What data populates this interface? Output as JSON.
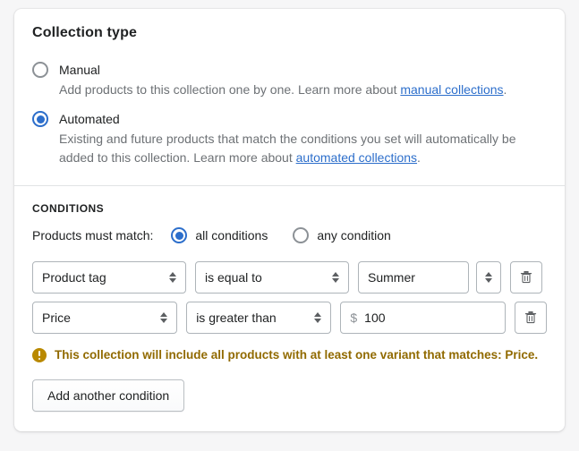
{
  "card": {
    "title": "Collection type",
    "options": [
      {
        "label": "Manual",
        "selected": false,
        "help_prefix": "Add products to this collection one by one. Learn more about ",
        "help_link": "manual collections",
        "help_suffix": "."
      },
      {
        "label": "Automated",
        "selected": true,
        "help_prefix": "Existing and future products that match the conditions you set will automatically be added to this collection. Learn more about ",
        "help_link": "automated collections",
        "help_suffix": "."
      }
    ]
  },
  "conditions": {
    "heading": "CONDITIONS",
    "match_label": "Products must match:",
    "match_options": [
      {
        "label": "all conditions",
        "selected": true
      },
      {
        "label": "any condition",
        "selected": false
      }
    ],
    "rows": [
      {
        "field": "Product tag",
        "operator": "is equal to",
        "value": "Summer",
        "currency_prefix": "",
        "has_stepper": true,
        "delete_icon": "trash-icon"
      },
      {
        "field": "Price",
        "operator": "is greater than",
        "value": "100",
        "currency_prefix": "$",
        "has_stepper": false,
        "delete_icon": "trash-icon"
      }
    ],
    "warning": {
      "icon": "alert-circle-icon",
      "text": "This collection will include all products with at least one variant that matches: Price.",
      "color": "#916a00"
    },
    "add_button": "Add another condition"
  },
  "colors": {
    "accent": "#2c6ecb",
    "warning": "#b98900",
    "border": "#aeb4b9",
    "page_bg": "#f6f6f7"
  }
}
